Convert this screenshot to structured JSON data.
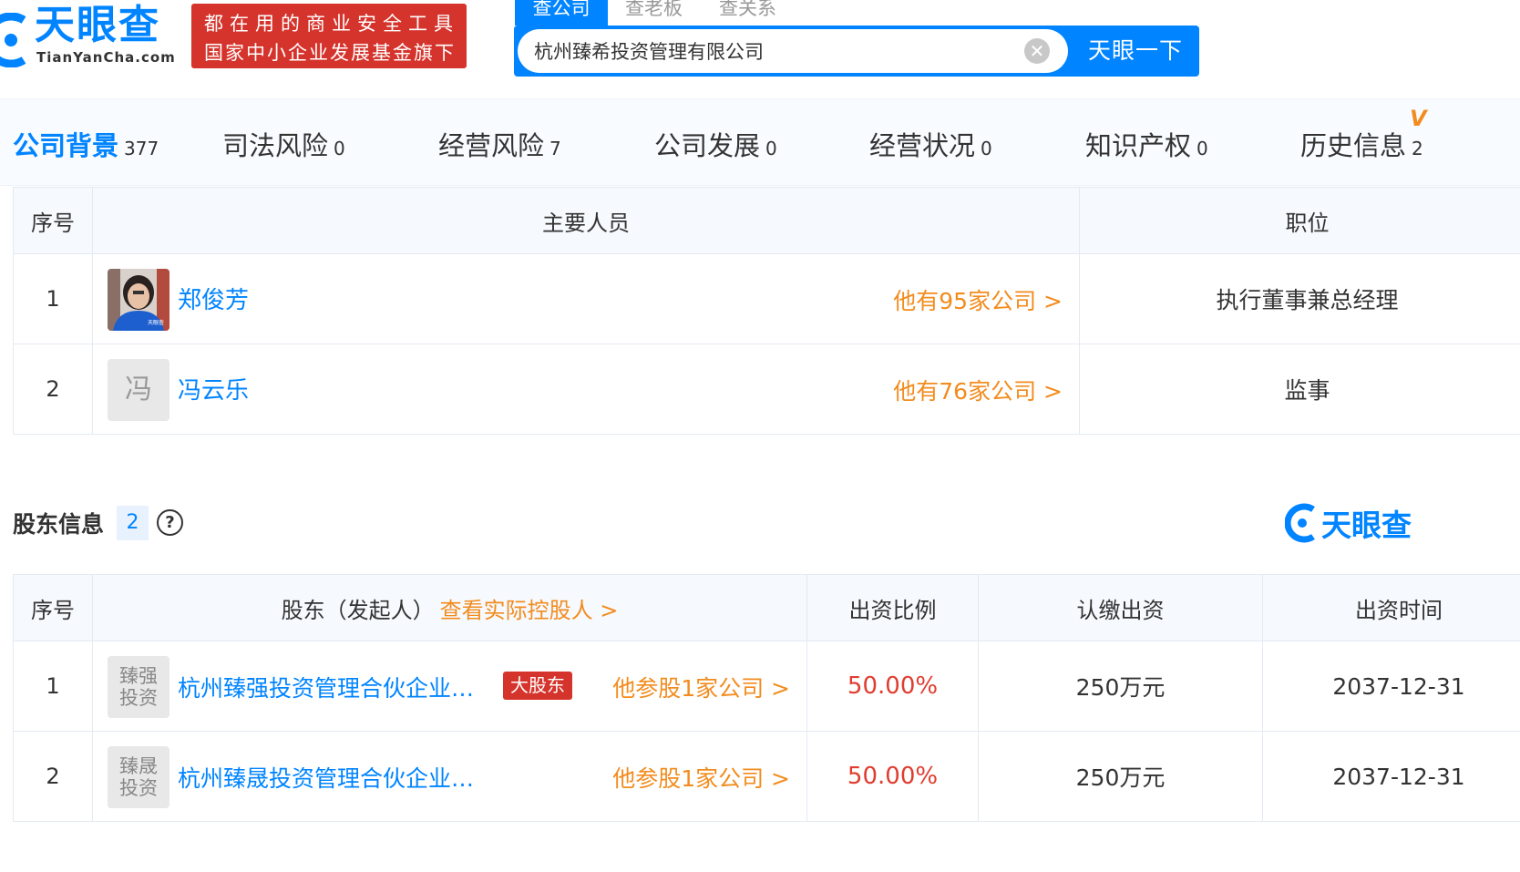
{
  "header": {
    "logo_text": "天眼查",
    "logo_sub": "TianYanCha.com",
    "banner_line1": "都在用的商业安全工具",
    "banner_line2": "国家中小企业发展基金旗下",
    "search_tabs": [
      "查公司",
      "查老板",
      "查关系"
    ],
    "search_value": "杭州臻希投资管理有限公司",
    "search_button": "天眼一下"
  },
  "nav": [
    {
      "label": "公司背景",
      "count": "377"
    },
    {
      "label": "司法风险",
      "count": "0"
    },
    {
      "label": "经营风险",
      "count": "7"
    },
    {
      "label": "公司发展",
      "count": "0"
    },
    {
      "label": "经营状况",
      "count": "0"
    },
    {
      "label": "知识产权",
      "count": "0"
    },
    {
      "label": "历史信息",
      "count": "2"
    }
  ],
  "vip_mark": "V",
  "staff": {
    "headers": {
      "index": "序号",
      "person": "主要人员",
      "position": "职位"
    },
    "rows": [
      {
        "index": "1",
        "name": "郑俊芳",
        "avatar": "",
        "link": "他有95家公司 >",
        "position": "执行董事兼总经理"
      },
      {
        "index": "2",
        "name": "冯云乐",
        "avatar": "冯",
        "link": "他有76家公司 >",
        "position": "监事"
      }
    ]
  },
  "shareholders": {
    "title": "股东信息",
    "count": "2",
    "help": "?",
    "watermark": "天眼查",
    "headers": {
      "index": "序号",
      "holder": "股东（发起人）",
      "holder_link": "查看实际控股人 >",
      "ratio": "出资比例",
      "amount": "认缴出资",
      "date": "出资时间"
    },
    "rows": [
      {
        "index": "1",
        "avatar": "臻强投资",
        "avatar_l1": "臻强",
        "avatar_l2": "投资",
        "name": "杭州臻强投资管理合伙企业…",
        "tag": "大股东",
        "link": "他参股1家公司 >",
        "ratio": "50.00%",
        "amount": "250万元",
        "date": "2037-12-31"
      },
      {
        "index": "2",
        "avatar": "臻晟投资",
        "avatar_l1": "臻晟",
        "avatar_l2": "投资",
        "name": "杭州臻晟投资管理合伙企业…",
        "tag": "",
        "link": "他参股1家公司 >",
        "ratio": "50.00%",
        "amount": "250万元",
        "date": "2037-12-31"
      }
    ]
  },
  "colors": {
    "brand": "#0084ff",
    "orange": "#f28c1e",
    "red": "#e03d2f",
    "banner": "#d5342c"
  }
}
